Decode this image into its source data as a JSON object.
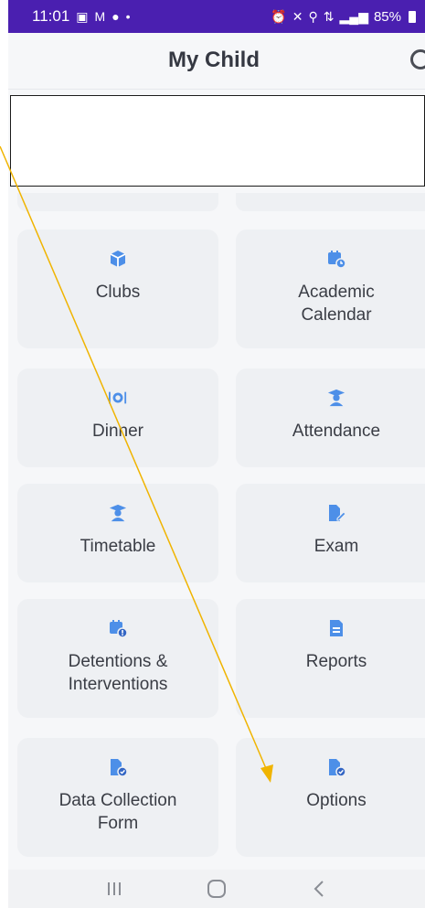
{
  "status_bar": {
    "time": "11:01",
    "battery": "85%",
    "left_icons": [
      "image-icon",
      "gmail-icon",
      "facebook-icon",
      "dot-icon"
    ],
    "right_icons": [
      "alarm-icon",
      "mute-icon",
      "location-icon",
      "lte-icon",
      "signal-icon",
      "battery-icon"
    ]
  },
  "header": {
    "title": "My Child"
  },
  "tiles": [
    {
      "label": "Clubs",
      "icon": "cube-icon"
    },
    {
      "label": "Academic\nCalendar",
      "icon": "calendar-clock-icon"
    },
    {
      "label": "Dinner",
      "icon": "dinner-icon"
    },
    {
      "label": "Attendance",
      "icon": "graduate-icon"
    },
    {
      "label": "Timetable",
      "icon": "graduate-icon"
    },
    {
      "label": "Exam",
      "icon": "document-pen-icon"
    },
    {
      "label": "Detentions &\nInterventions",
      "icon": "calendar-alert-icon"
    },
    {
      "label": "Reports",
      "icon": "report-icon"
    },
    {
      "label": "Data Collection\nForm",
      "icon": "document-check-icon"
    },
    {
      "label": "Options",
      "icon": "document-check-icon"
    }
  ],
  "nav_bar": {
    "buttons": [
      "recent-apps",
      "home",
      "back"
    ]
  },
  "colors": {
    "status_bar": "#4a1fb0",
    "tile_bg": "#eef0f3",
    "icon_blue": "#4d8fe8",
    "annotation_arrow": "#f0b400"
  }
}
